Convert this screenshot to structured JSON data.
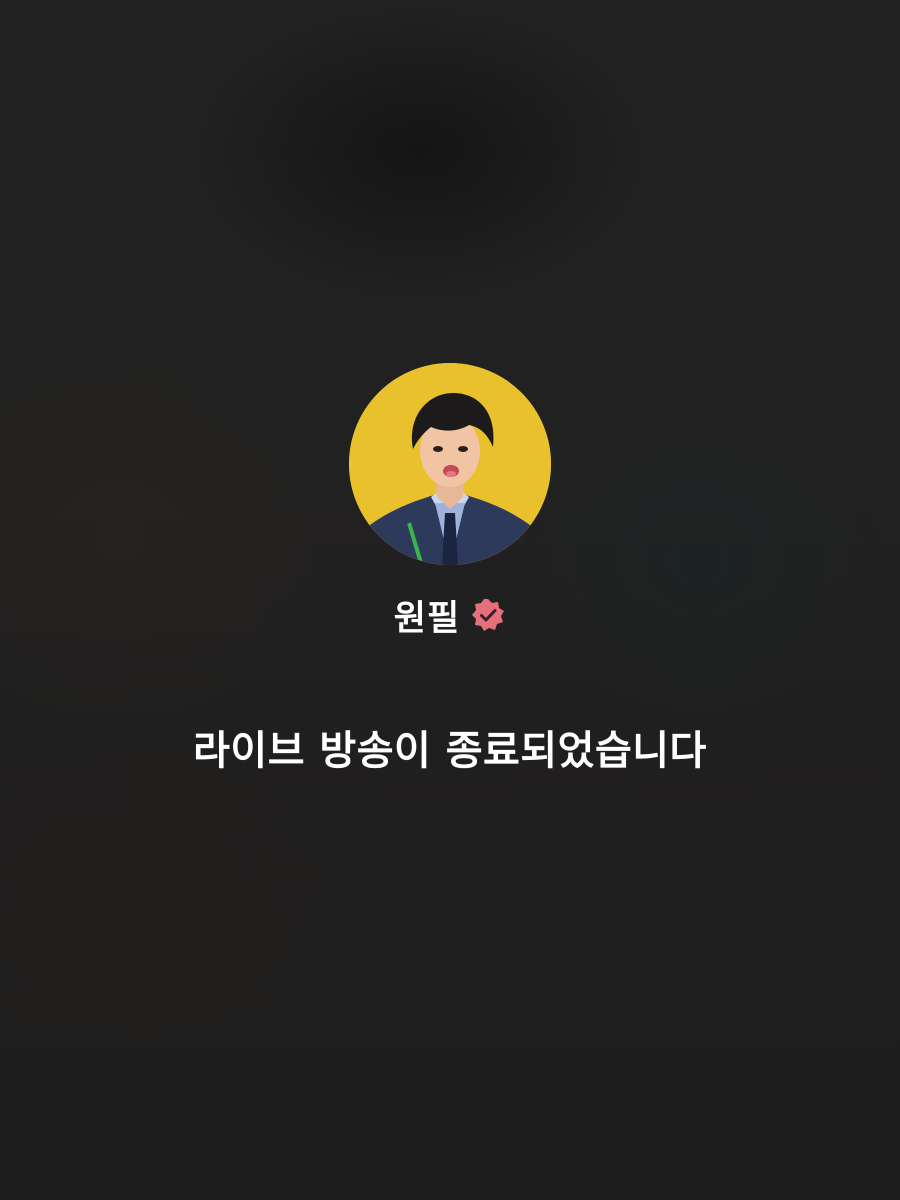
{
  "profile": {
    "name": "원필",
    "avatar_background": "#e8c12c",
    "verified_icon": "verified-badge-icon",
    "verified_color": "#e5707b"
  },
  "live": {
    "status_message": "라이브 방송이 종료되었습니다"
  }
}
